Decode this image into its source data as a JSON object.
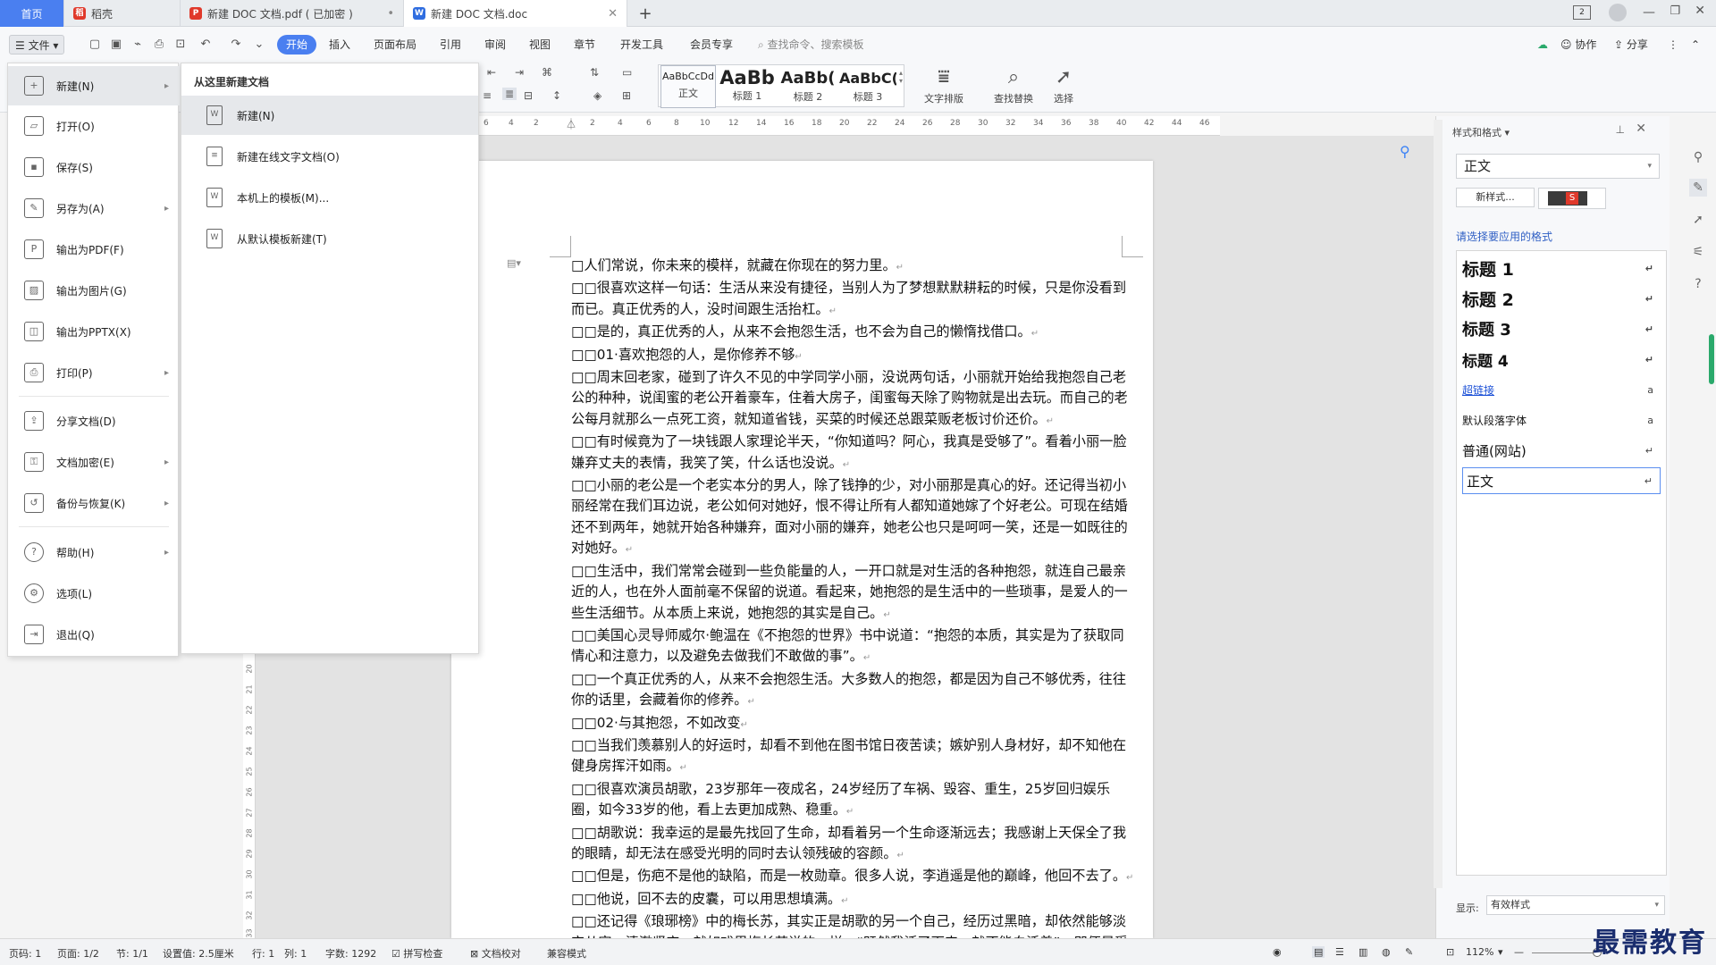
{
  "tabs": [
    {
      "label": "首页"
    },
    {
      "label": "稻壳"
    },
    {
      "label": "新建 DOC 文档.pdf ( 已加密 )"
    },
    {
      "label": "新建 DOC 文档.doc"
    }
  ],
  "tab_new": "+",
  "toolbar": {
    "file": "文件",
    "menus": [
      "开始",
      "插入",
      "页面布局",
      "引用",
      "审阅",
      "视图",
      "章节",
      "开发工具",
      "会员专享"
    ],
    "search_placeholder": "查找命令、搜索模板",
    "collab": "协作",
    "share": "分享"
  },
  "ribbon": {
    "styles": [
      {
        "sample": "AaBbCcDd",
        "label": "正文"
      },
      {
        "sample": "AaBb",
        "label": "标题 1"
      },
      {
        "sample": "AaBb(",
        "label": "标题 2"
      },
      {
        "sample": "AaBbC(",
        "label": "标题 3"
      }
    ],
    "text_layout": "文字排版",
    "find_replace": "查找替换",
    "select": "选择"
  },
  "ruler": [
    "6",
    "4",
    "2",
    "2",
    "4",
    "6",
    "8",
    "10",
    "12",
    "14",
    "16",
    "18",
    "20",
    "22",
    "24",
    "26",
    "28",
    "30",
    "32",
    "34",
    "36",
    "38",
    "40",
    "42",
    "44",
    "46"
  ],
  "vruler": [
    "20",
    "21",
    "22",
    "23",
    "24",
    "25",
    "26",
    "27",
    "28",
    "29",
    "30",
    "31",
    "32",
    "33"
  ],
  "file_menu": [
    {
      "label": "新建(N)",
      "icon": "new-doc-icon",
      "sub": true
    },
    {
      "label": "打开(O)",
      "icon": "folder-open-icon",
      "sub": false
    },
    {
      "label": "保存(S)",
      "icon": "save-icon",
      "sub": false
    },
    {
      "label": "另存为(A)",
      "icon": "save-as-icon",
      "sub": true
    },
    {
      "label": "输出为PDF(F)",
      "icon": "pdf-icon",
      "sub": false
    },
    {
      "label": "输出为图片(G)",
      "icon": "image-icon",
      "sub": false
    },
    {
      "label": "输出为PPTX(X)",
      "icon": "pptx-icon",
      "sub": false
    },
    {
      "label": "打印(P)",
      "icon": "print-icon",
      "sub": true
    },
    {
      "label": "分享文档(D)",
      "icon": "share-icon",
      "sub": false
    },
    {
      "label": "文档加密(E)",
      "icon": "lock-icon",
      "sub": true
    },
    {
      "label": "备份与恢复(K)",
      "icon": "backup-icon",
      "sub": true
    },
    {
      "label": "帮助(H)",
      "icon": "help-icon",
      "sub": true
    },
    {
      "label": "选项(L)",
      "icon": "gear-icon",
      "sub": false
    },
    {
      "label": "退出(Q)",
      "icon": "exit-icon",
      "sub": false
    }
  ],
  "submenu": {
    "title": "从这里新建文档",
    "items": [
      {
        "label": "新建(N)"
      },
      {
        "label": "新建在线文字文档(O)"
      },
      {
        "label": "本机上的模板(M)..."
      },
      {
        "label": "从默认模板新建(T)"
      }
    ]
  },
  "document": {
    "paragraphs": [
      "□人们常说，你未来的模样，就藏在你现在的努力里。",
      "□□很喜欢这样一句话：生活从来没有捷径，当别人为了梦想默默耕耘的时候，只是你没看到而已。真正优秀的人，没时间跟生活抬杠。",
      "□□是的，真正优秀的人，从来不会抱怨生活，也不会为自己的懒惰找借口。",
      "□□01·喜欢抱怨的人，是你修养不够",
      "□□周末回老家，碰到了许久不见的中学同学小丽，没说两句话，小丽就开始给我抱怨自己老公的种种，说闺蜜的老公开着豪车，住着大房子，闺蜜每天除了购物就是出去玩。而自己的老公每月就那么一点死工资，就知道省钱，买菜的时候还总跟菜贩老板讨价还价。",
      "□□有时候竟为了一块钱跟人家理论半天，“你知道吗？阿心，我真是受够了”。看着小丽一脸嫌弃丈夫的表情，我笑了笑，什么话也没说。",
      "□□小丽的老公是一个老实本分的男人，除了钱挣的少，对小丽那是真心的好。还记得当初小丽经常在我们耳边说，老公如何对她好，恨不得让所有人都知道她嫁了个好老公。可现在结婚还不到两年，她就开始各种嫌弃，面对小丽的嫌弃，她老公也只是呵呵一笑，还是一如既往的对她好。",
      "□□生活中，我们常常会碰到一些负能量的人，一开口就是对生活的各种抱怨，就连自己最亲近的人，也在外人面前毫不保留的说道。看起来，她抱怨的是生活中的一些琐事，是爱人的一些生活细节。从本质上来说，她抱怨的其实是自己。",
      "□□美国心灵导师威尔·鲍温在《不抱怨的世界》书中说道：“抱怨的本质，其实是为了获取同情心和注意力，以及避免去做我们不敢做的事”。",
      "□□一个真正优秀的人，从来不会抱怨生活。大多数人的抱怨，都是因为自己不够优秀，往往你的话里，会藏着你的修养。",
      "□□02·与其抱怨，不如改变",
      "□□当我们羡慕别人的好运时，却看不到他在图书馆日夜苦读；嫉妒别人身材好，却不知他在健身房挥汗如雨。",
      "□□很喜欢演员胡歌，23岁那年一夜成名，24岁经历了车祸、毁容、重生，25岁回归娱乐圈，如今33岁的他，看上去更加成熟、稳重。",
      "□□胡歌说：我幸运的是最先找回了生命，却看着另一个生命逐渐远去；我感谢上天保全了我的眼睛，却无法在感受光明的同时去认领残破的容颜。",
      "□□但是，伤疤不是他的缺陷，而是一枚勋章。很多人说，李逍遥是他的巅峰，他回不去了。",
      "□□他说，回不去的皮囊，可以用思想填满。",
      "□□还记得《琅琊榜》中的梅长苏，其实正是胡歌的另一个自己，经历过黑暗，却依然能够淡定从容，清澈坚定。就如戏里梅长苏说的一样：“既然我活了下来，就不能白活着”。即便是受过伤，也可以走出更好的人生。"
    ]
  },
  "right_pane": {
    "title": "样式和格式",
    "current_style": "正文",
    "new_style": "新样式...",
    "hint": "请选择要应用的格式",
    "styles": [
      {
        "label": "标题 1",
        "mark": "↵"
      },
      {
        "label": "标题 2",
        "mark": "↵"
      },
      {
        "label": "标题 3",
        "mark": "↵"
      },
      {
        "label": "标题 4",
        "mark": "↵"
      },
      {
        "label": "超链接",
        "mark": "a"
      },
      {
        "label": "默认段落字体",
        "mark": "a"
      },
      {
        "label": "普通(网站)",
        "mark": "↵"
      },
      {
        "label": "正文",
        "mark": "↵"
      }
    ],
    "show_label": "显示:",
    "show_value": "有效样式"
  },
  "status": {
    "page_no": "页码: 1",
    "pages": "页面: 1/2",
    "section": "节: 1/1",
    "setting": "设置值: 2.5厘米",
    "row": "行: 1",
    "col": "列: 1",
    "words": "字数: 1292",
    "spell": "拼写检查",
    "proof": "文档校对",
    "compat": "兼容模式",
    "zoom": "112%"
  },
  "watermark": "最需教育",
  "colors": {
    "accent": "#4a7ff0",
    "home_tab": "#4a7ff0",
    "watermark": "#1a2d6e"
  }
}
